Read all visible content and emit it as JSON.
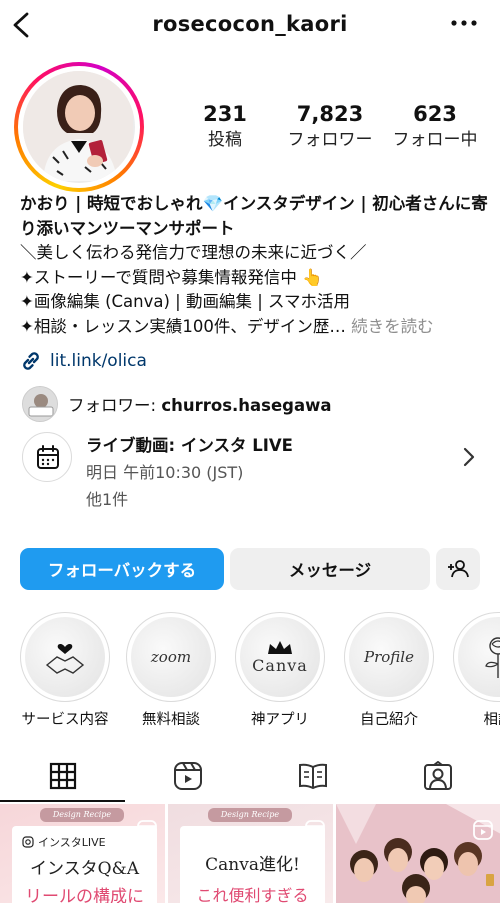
{
  "header": {
    "username": "rosecocon_kaori"
  },
  "stats": [
    {
      "value": "231",
      "label": "投稿"
    },
    {
      "value": "7,823",
      "label": "フォロワー"
    },
    {
      "value": "623",
      "label": "フォロー中"
    }
  ],
  "bio": {
    "name_part1": "かおり | 時短でおしゃれ",
    "name_part2": "インスタデザイン | 初心者さんに寄り添いマンツーマンサポート",
    "line1": "＼美しく伝わる発信力で理想の未来に近づく／",
    "line2": "✦ストーリーで質問や募集情報発信中",
    "line3": "✦画像編集 (Canva) | 動画編集 | スマホ活用",
    "line4": "✦相談・レッスン実績100件、デザイン歴…",
    "more_label": "続きを読む"
  },
  "link": {
    "text": "lit.link/olica"
  },
  "followed_by": {
    "prefix": "フォロワー: ",
    "user": "churros.hasegawa"
  },
  "event": {
    "title": "ライブ動画: インスタ LIVE",
    "time": "明日 午前10:30 (JST)",
    "count": "他1件"
  },
  "buttons": {
    "follow_back": "フォローバックする",
    "message": "メッセージ"
  },
  "highlights": [
    {
      "caption": "サービス内容",
      "icon": "heart-handshake-icon"
    },
    {
      "caption": "無料相談",
      "word": "zoom"
    },
    {
      "caption": "神アプリ",
      "word": "Canva",
      "icon": "crown-icon"
    },
    {
      "caption": "自己紹介",
      "word": "Profile"
    },
    {
      "caption": "相談",
      "icon": "rose-icon"
    }
  ],
  "tabs": [
    "grid-icon",
    "reels-icon",
    "guide-icon",
    "tagged-icon"
  ],
  "posts": [
    {
      "tag": "Design Recipe",
      "label": "インスタLIVE",
      "title": "インスタQ&A",
      "subtitle": "リールの構成に"
    },
    {
      "tag": "Design Recipe",
      "title": "Canva進化!",
      "subtitle": "これ便利すぎる"
    },
    {
      "type": "photo"
    }
  ],
  "colors": {
    "primary_button": "#1f9bf0",
    "link": "#00376b",
    "accent_pink": "#e04a72"
  }
}
